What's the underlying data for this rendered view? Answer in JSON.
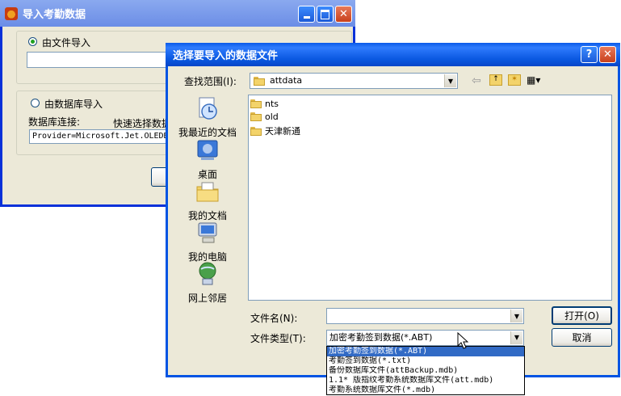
{
  "back_window": {
    "title": "导入考勤数据",
    "radio_file": "由文件导入",
    "radio_db": "由数据库导入",
    "db_conn_label": "数据库连接:",
    "quick_select": "快速选择数据",
    "conn_value": "Provider=Microsoft.Jet.OLEDB"
  },
  "dialog": {
    "title": "选择要导入的数据文件",
    "help_btn": "?",
    "close_btn": "✕",
    "look_in_label": "查找范围(I):",
    "look_in_value": "attdata",
    "places": [
      {
        "label": "我最近的文档",
        "icon": "recent-documents-icon"
      },
      {
        "label": "桌面",
        "icon": "desktop-icon"
      },
      {
        "label": "我的文档",
        "icon": "my-documents-icon"
      },
      {
        "label": "我的电脑",
        "icon": "my-computer-icon"
      },
      {
        "label": "网上邻居",
        "icon": "network-places-icon"
      }
    ],
    "files": [
      "nts",
      "old",
      "天津新通"
    ],
    "filename_label": "文件名(N):",
    "filename_value": "",
    "filetype_label": "文件类型(T):",
    "filetype_value": "加密考勤签到数据(*.ABT)",
    "open_btn": "打开(O)",
    "cancel_btn": "取消",
    "filetype_options": [
      "加密考勤签到数据(*.ABT)",
      "考勤签到数据(*.txt)",
      "备份数据库文件(attBackup.mdb)",
      "1.1* 版指纹考勤系统数据库文件(att.mdb)",
      "考勤系统数据库文件(*.mdb)"
    ]
  }
}
